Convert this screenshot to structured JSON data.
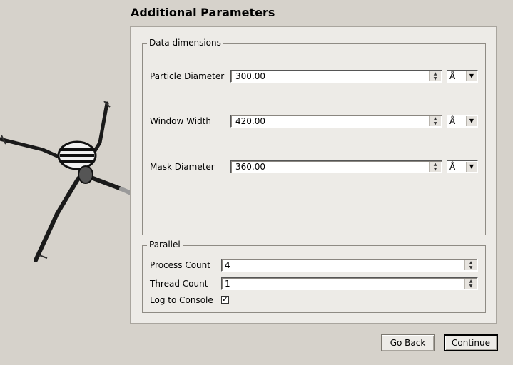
{
  "page": {
    "title": "Additional Parameters"
  },
  "data_dimensions": {
    "legend": "Data dimensions",
    "rows": [
      {
        "label": "Particle Diameter",
        "value": "300.00",
        "unit": "Å"
      },
      {
        "label": "Window Width",
        "value": "420.00",
        "unit": "Å"
      },
      {
        "label": "Mask Diameter",
        "value": "360.00",
        "unit": "Å"
      }
    ]
  },
  "parallel": {
    "legend": "Parallel",
    "process_label": "Process Count",
    "process_value": "4",
    "thread_label": "Thread Count",
    "thread_value": "1",
    "log_label": "Log to Console",
    "log_checked": "✓"
  },
  "buttons": {
    "back": "Go Back",
    "continue": "Continue"
  },
  "icons": {
    "spin_up": "▲",
    "spin_down": "▼",
    "dropdown": "▼",
    "decoration": "spider-illustration"
  }
}
